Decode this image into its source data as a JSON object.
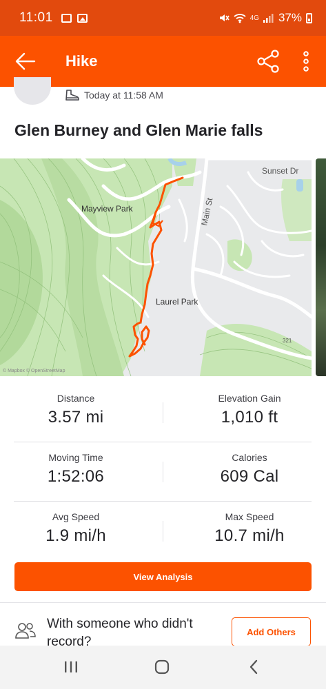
{
  "status_bar": {
    "time": "11:01",
    "network": "4G",
    "battery": "37%"
  },
  "app_bar": {
    "title": "Hike"
  },
  "activity": {
    "timestamp": "Today at 11:58 AM",
    "title": "Glen Burney and Glen Marie falls"
  },
  "map": {
    "labels": {
      "sunset_dr": "Sunset Dr",
      "main_st": "Main St",
      "mayview_park": "Mayview Park",
      "laurel_park": "Laurel Park",
      "route_321": "321"
    },
    "attribution": "© Mapbox © OpenStreetMap",
    "route_color": "#fc5200",
    "land_color": "#c7e6b4",
    "road_color": "#ffffff"
  },
  "stats": [
    {
      "label": "Distance",
      "value": "3.57 mi"
    },
    {
      "label": "Elevation Gain",
      "value": "1,010 ft"
    },
    {
      "label": "Moving Time",
      "value": "1:52:06"
    },
    {
      "label": "Calories",
      "value": "609 Cal"
    },
    {
      "label": "Avg Speed",
      "value": "1.9 mi/h"
    },
    {
      "label": "Max Speed",
      "value": "10.7 mi/h"
    }
  ],
  "actions": {
    "view_analysis": "View Analysis",
    "record_prompt": "With someone who didn't record?",
    "add_others": "Add Others"
  },
  "colors": {
    "brand": "#fc5200",
    "status_bar": "#e24a0d"
  }
}
